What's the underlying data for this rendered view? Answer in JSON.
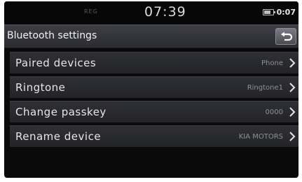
{
  "status_bar": {
    "left_text": "REG",
    "clock": "07:39",
    "right_text": "0:07"
  },
  "title_bar": {
    "title": "Bluetooth settings",
    "back_icon": "back-arrow-icon"
  },
  "items": [
    {
      "label": "Paired devices",
      "value": "Phone"
    },
    {
      "label": "Ringtone",
      "value": "Ringtone1"
    },
    {
      "label": "Change passkey",
      "value": "0000"
    },
    {
      "label": "Rename device",
      "value": "KIA MOTORS"
    }
  ],
  "colors": {
    "background": "#0a0a0b",
    "title_bar": "#3e3f45",
    "list_item": "#2f3035",
    "text": "#e6e6e6",
    "value_text": "#8f9095"
  }
}
